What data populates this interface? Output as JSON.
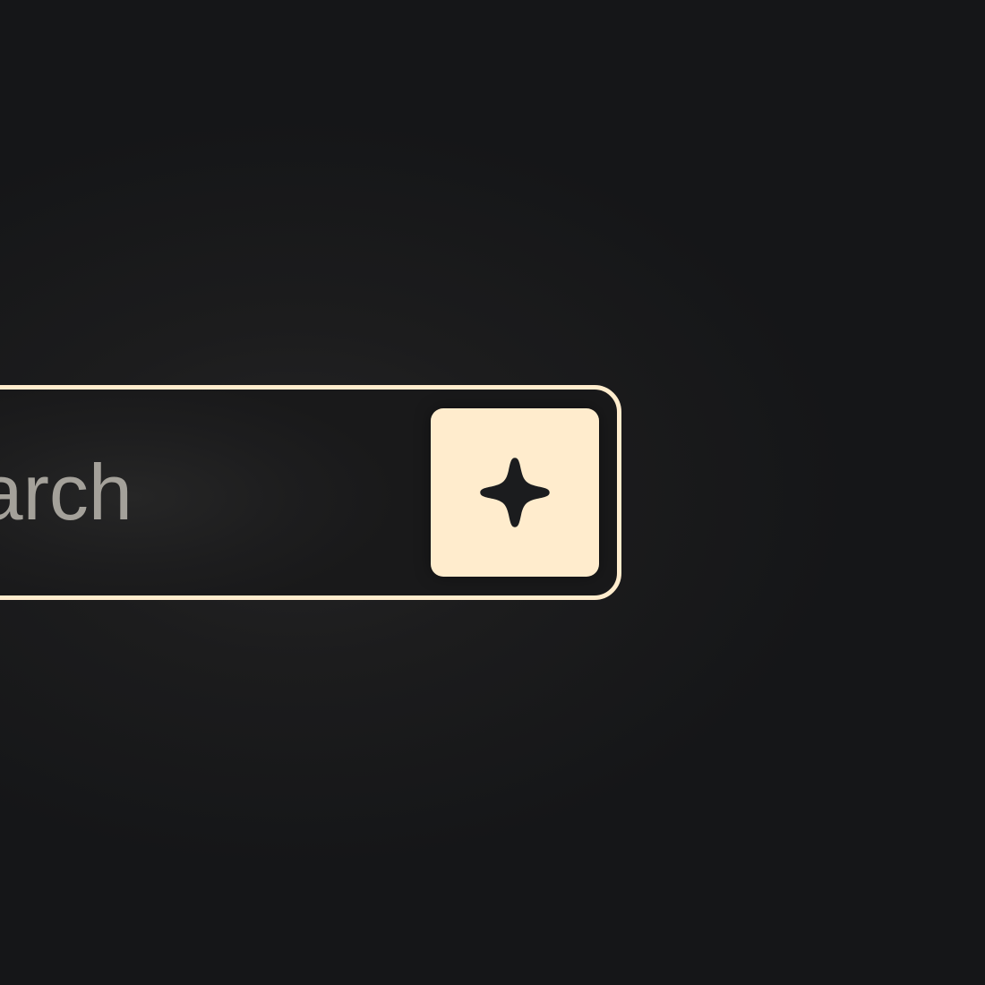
{
  "search": {
    "placeholder": "Search",
    "value": ""
  },
  "ai_button": {
    "icon": "sparkle-icon",
    "label": ""
  },
  "colors": {
    "background": "#151618",
    "accent": "#ffeccd",
    "placeholder_text": "#a4a19a",
    "icon": "#1b1c1e"
  }
}
